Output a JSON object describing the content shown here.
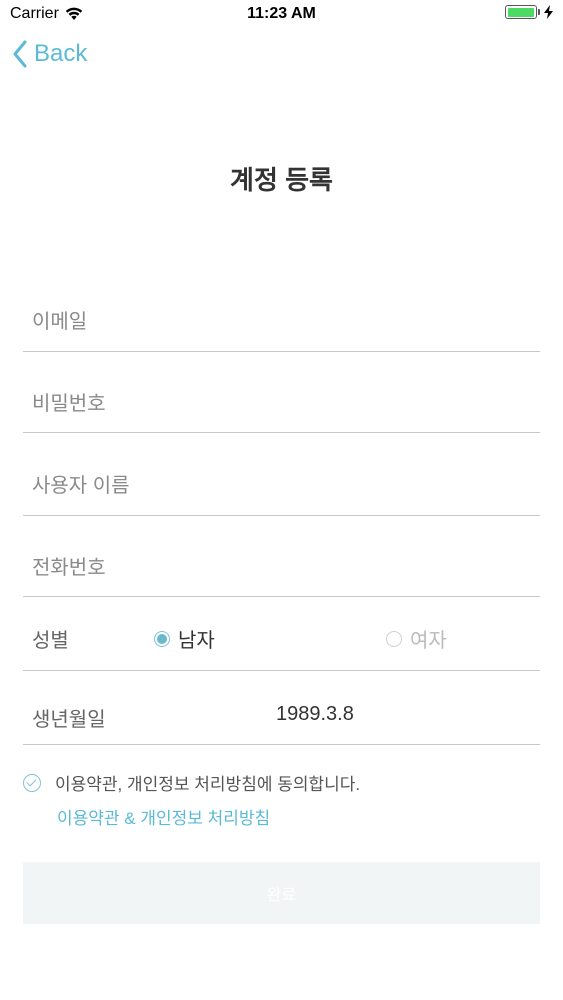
{
  "status_bar": {
    "carrier": "Carrier",
    "time": "11:23 AM"
  },
  "nav": {
    "back_label": "Back"
  },
  "page": {
    "title": "계정 등록"
  },
  "form": {
    "email_placeholder": "이메일",
    "password_placeholder": "비밀번호",
    "username_placeholder": "사용자 이름",
    "phone_placeholder": "전화번호",
    "gender": {
      "label": "성별",
      "options": [
        "남자",
        "여자"
      ],
      "selected": "남자"
    },
    "birthdate": {
      "label": "생년월일",
      "value": "1989.3.8"
    },
    "agree_text": "이용약관, 개인정보 처리방침에 동의합니다.",
    "terms_link": "이용약관 & 개인정보 처리방침",
    "submit_label": "완료"
  },
  "colors": {
    "accent": "#5bbad5",
    "battery": "#4cd964",
    "submit_bg": "#f2f5f6"
  },
  "icons": {
    "wifi": "wifi-icon",
    "charging": "bolt-icon",
    "back": "chevron-left-icon",
    "check": "check-circle-icon"
  }
}
